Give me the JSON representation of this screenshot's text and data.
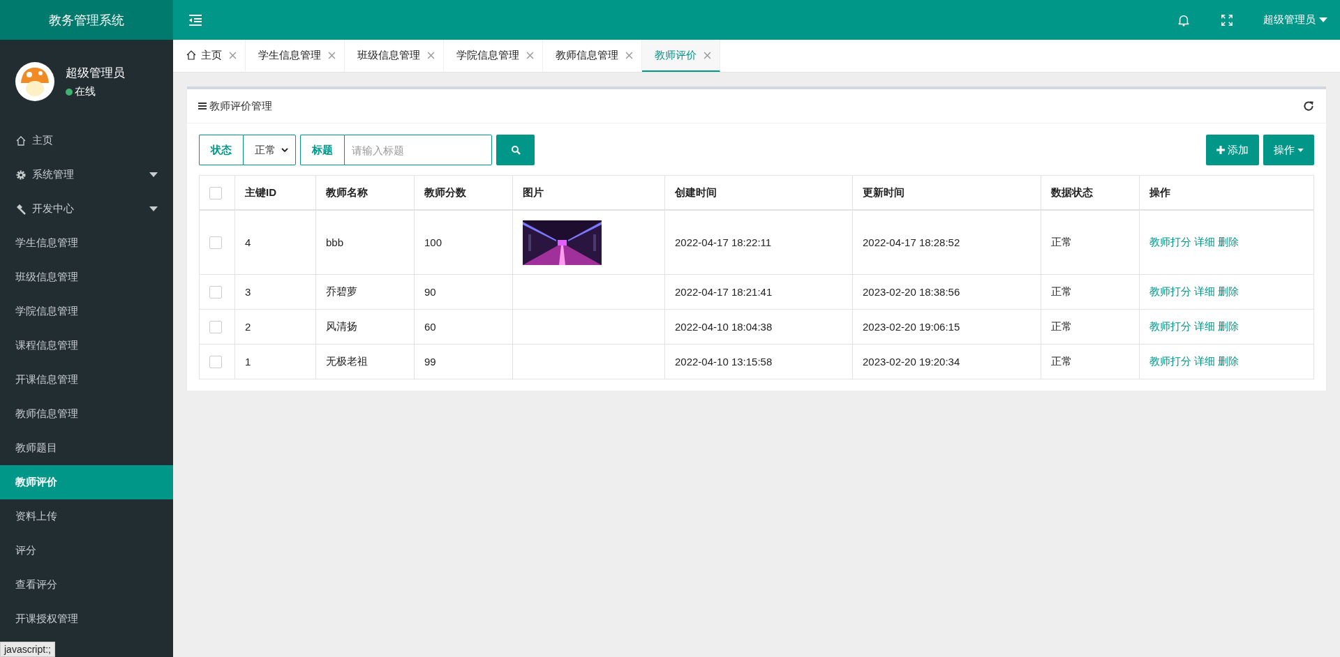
{
  "app_title": "教务管理系统",
  "topbar": {
    "user_menu": "超级管理员"
  },
  "user": {
    "name": "超级管理员",
    "status": "在线",
    "online": true
  },
  "sidebar": {
    "items": [
      {
        "label": "主页",
        "kind": "home",
        "selected": false
      },
      {
        "label": "系统管理",
        "kind": "settings-group",
        "selected": false
      },
      {
        "label": "开发中心",
        "kind": "dev-group",
        "selected": false
      },
      {
        "label": "学生信息管理",
        "kind": "link",
        "selected": false
      },
      {
        "label": "班级信息管理",
        "kind": "link",
        "selected": false
      },
      {
        "label": "学院信息管理",
        "kind": "link",
        "selected": false
      },
      {
        "label": "课程信息管理",
        "kind": "link",
        "selected": false
      },
      {
        "label": "开课信息管理",
        "kind": "link",
        "selected": false
      },
      {
        "label": "教师信息管理",
        "kind": "link",
        "selected": false
      },
      {
        "label": "教师题目",
        "kind": "link",
        "selected": false
      },
      {
        "label": "教师评价",
        "kind": "link",
        "selected": true
      },
      {
        "label": "资料上传",
        "kind": "link",
        "selected": false
      },
      {
        "label": "评分",
        "kind": "link",
        "selected": false
      },
      {
        "label": "查看评分",
        "kind": "link",
        "selected": false
      },
      {
        "label": "开课授权管理",
        "kind": "link",
        "selected": false
      }
    ]
  },
  "tabs": [
    {
      "label": "主页",
      "kind": "home",
      "selected": false
    },
    {
      "label": "学生信息管理",
      "kind": "page",
      "selected": false
    },
    {
      "label": "班级信息管理",
      "kind": "page",
      "selected": false
    },
    {
      "label": "学院信息管理",
      "kind": "page",
      "selected": false
    },
    {
      "label": "教师信息管理",
      "kind": "page",
      "selected": false
    },
    {
      "label": "教师评价",
      "kind": "page",
      "selected": true
    }
  ],
  "panel": {
    "title": "教师评价管理"
  },
  "filters": {
    "status_label": "状态",
    "status_value": "正常",
    "title_label": "标题",
    "title_placeholder": "请输入标题"
  },
  "buttons": {
    "add": "添加",
    "actions": "操作"
  },
  "table": {
    "header_checked": false,
    "columns": [
      "主键ID",
      "教师名称",
      "教师分数",
      "图片",
      "创建时间",
      "更新时间",
      "数据状态",
      "操作"
    ],
    "rows": [
      {
        "checked": false,
        "id": "4",
        "name": "bbb",
        "score": "100",
        "image": {
          "kind": "picture"
        },
        "created": "2022-04-17 18:22:11",
        "updated": "2022-04-17 18:28:52",
        "status": "正常",
        "actions": [
          "教师打分",
          "详细",
          "删除"
        ]
      },
      {
        "checked": false,
        "id": "3",
        "name": "乔碧萝",
        "score": "90",
        "created": "2022-04-17 18:21:41",
        "updated": "2023-02-20 18:38:56",
        "status": "正常",
        "actions": [
          "教师打分",
          "详细",
          "删除"
        ]
      },
      {
        "checked": false,
        "id": "2",
        "name": "风清扬",
        "score": "60",
        "created": "2022-04-10 18:04:38",
        "updated": "2023-02-20 19:06:15",
        "status": "正常",
        "actions": [
          "教师打分",
          "详细",
          "删除"
        ]
      },
      {
        "checked": false,
        "id": "1",
        "name": "无极老祖",
        "score": "99",
        "created": "2022-04-10 13:15:58",
        "updated": "2023-02-20 19:20:34",
        "status": "正常",
        "actions": [
          "教师打分",
          "详细",
          "删除"
        ]
      }
    ]
  },
  "status_tooltip": "javascript:;"
}
